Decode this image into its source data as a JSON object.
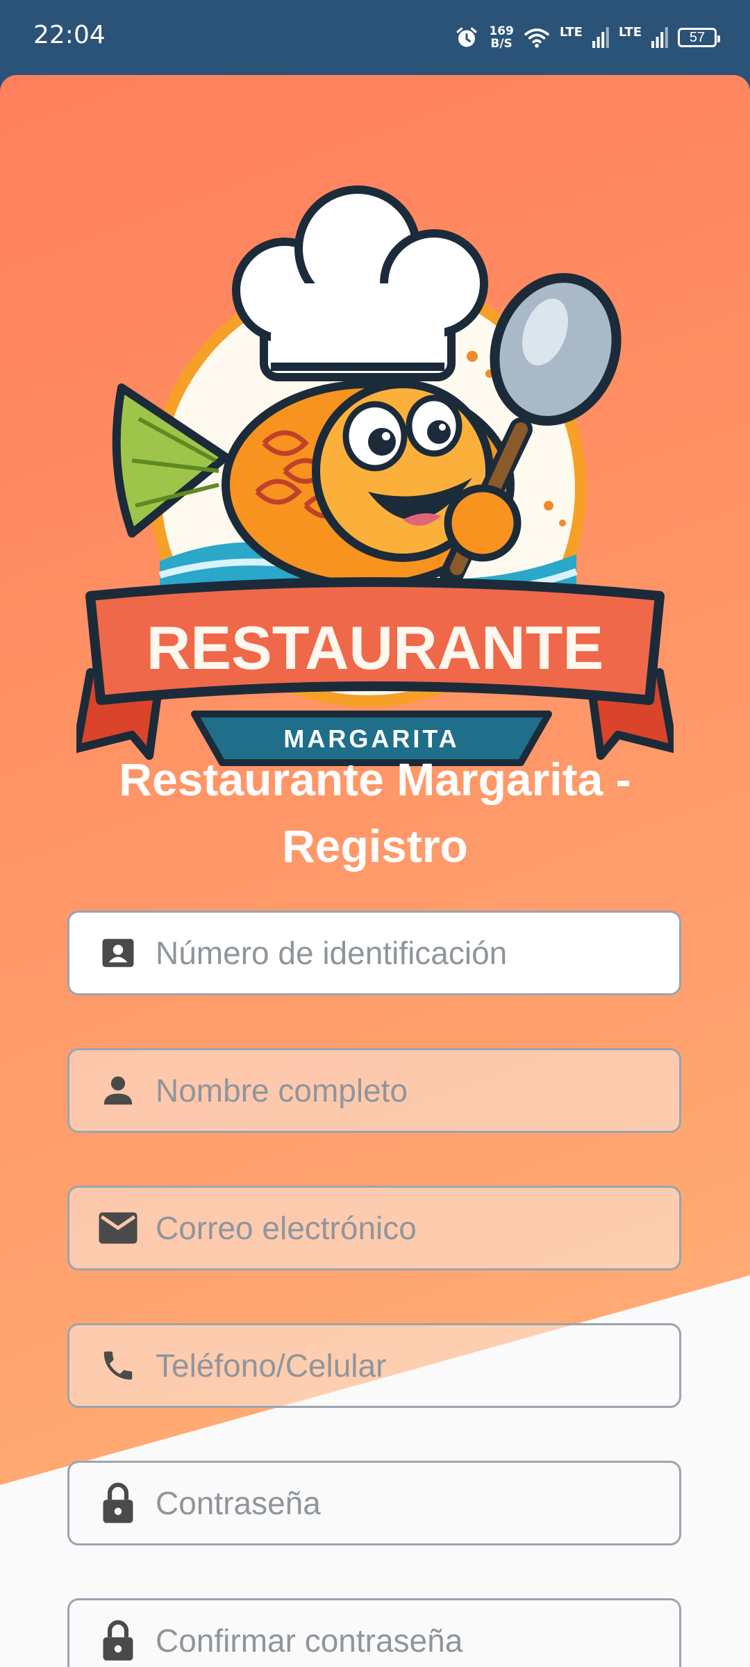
{
  "status_bar": {
    "time": "22:04",
    "net_speed_value": "169",
    "net_speed_unit": "B/S",
    "lte1": "LTE",
    "lte2": "LTE",
    "battery": "57"
  },
  "logo": {
    "banner_text": "RESTAURANTE",
    "sub_text": "MARGARITA"
  },
  "page": {
    "title_line1": "Restaurante Margarita -",
    "title_line2": "Registro"
  },
  "form": {
    "fields": [
      {
        "placeholder": "Número de identificación",
        "icon": "badge-icon"
      },
      {
        "placeholder": "Nombre completo",
        "icon": "person-icon"
      },
      {
        "placeholder": "Correo electrónico",
        "icon": "mail-icon"
      },
      {
        "placeholder": "Teléfono/Celular",
        "icon": "phone-icon"
      },
      {
        "placeholder": "Contraseña",
        "icon": "lock-icon"
      },
      {
        "placeholder": "Confirmar contraseña",
        "icon": "lock-icon"
      }
    ]
  },
  "colors": {
    "status_bar": "#2b5277",
    "gradient_start": "#ff7f5c",
    "gradient_end": "#ffb580",
    "icon": "#4a4a4a"
  }
}
